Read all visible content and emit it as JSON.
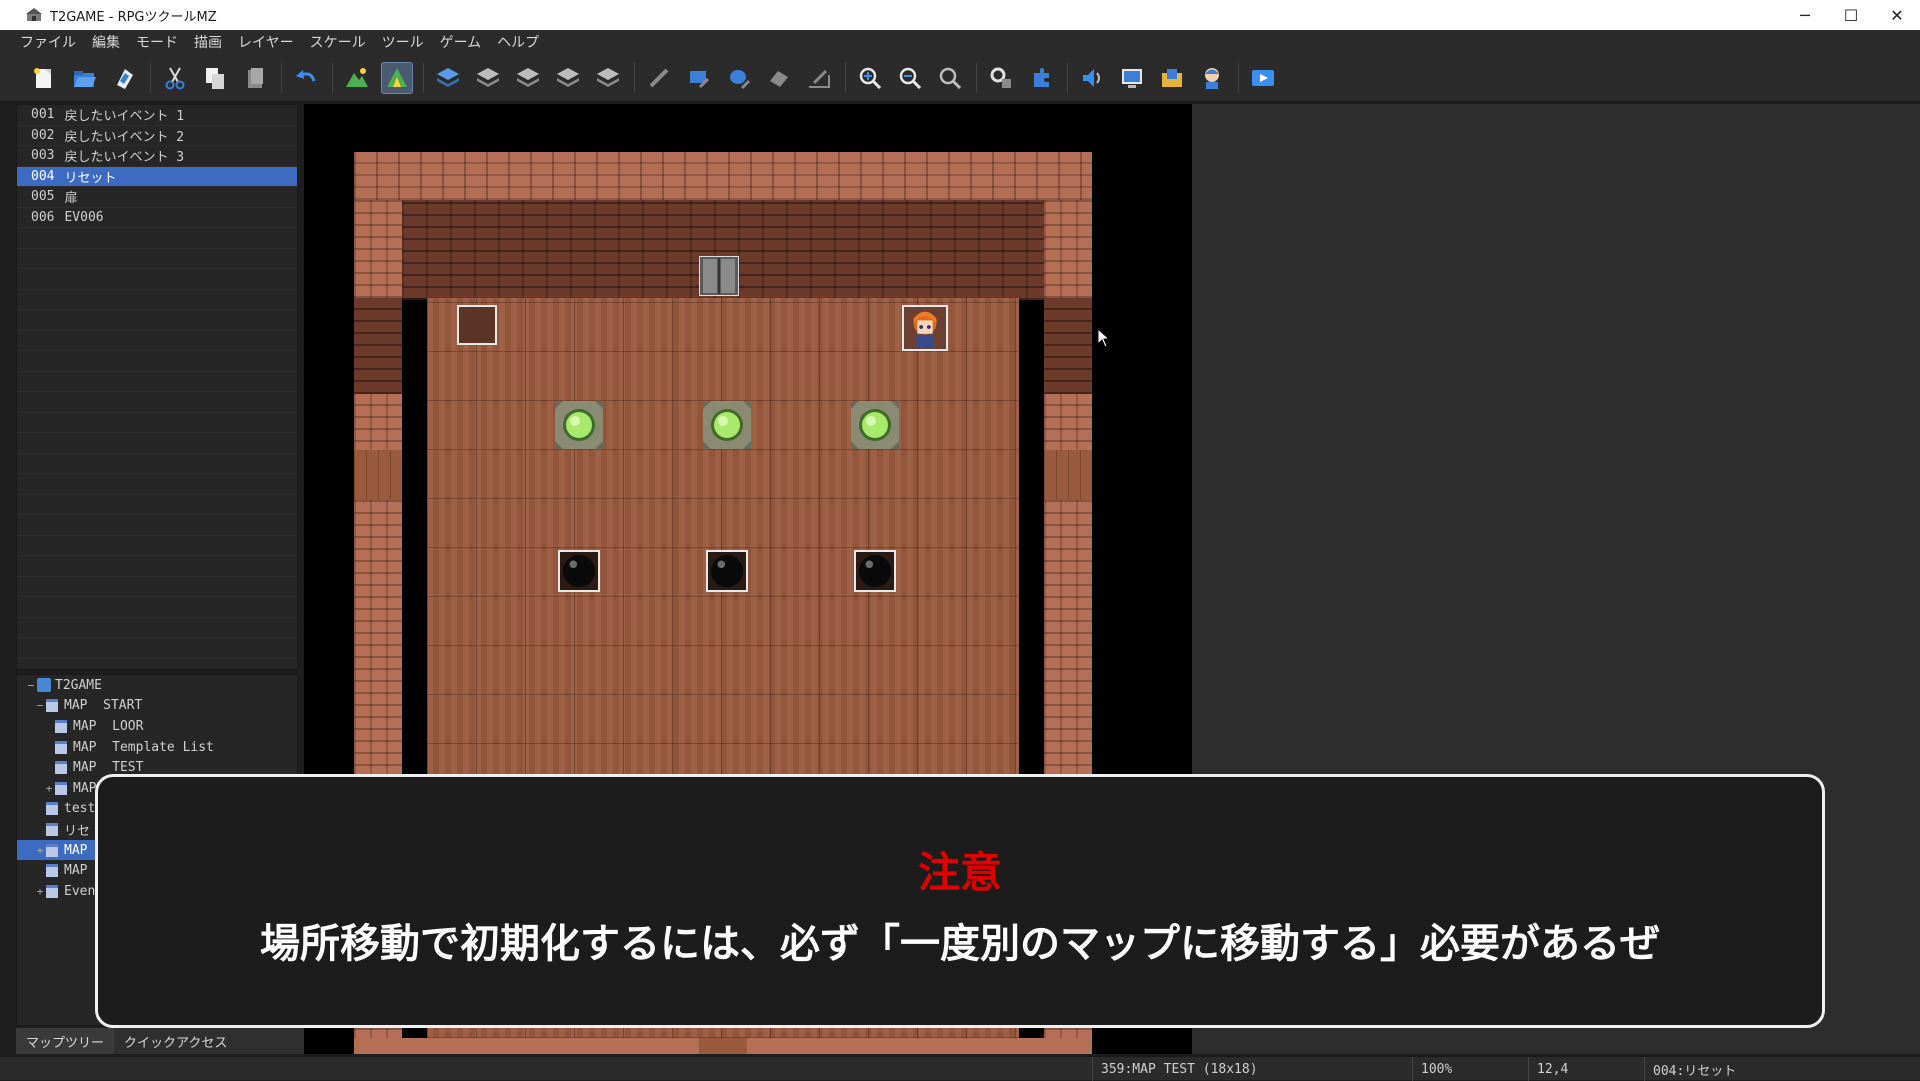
{
  "window": {
    "title": "T2GAME - RPGツクールMZ"
  },
  "menu": [
    "ファイル",
    "編集",
    "モード",
    "描画",
    "レイヤー",
    "スケール",
    "ツール",
    "ゲーム",
    "ヘルプ"
  ],
  "events": [
    {
      "num": "001",
      "name": "戻したいイベント 1"
    },
    {
      "num": "002",
      "name": "戻したいイベント 2"
    },
    {
      "num": "003",
      "name": "戻したいイベント 3"
    },
    {
      "num": "004",
      "name": "リセット"
    },
    {
      "num": "005",
      "name": "扉"
    },
    {
      "num": "006",
      "name": "EV006"
    }
  ],
  "tree": [
    {
      "label": "T2GAME",
      "indent": 0,
      "toggle": "−",
      "type": "project"
    },
    {
      "label": "MAP  START",
      "indent": 1,
      "toggle": "−",
      "type": "map"
    },
    {
      "label": "MAP  LOOR",
      "indent": 2,
      "toggle": "",
      "type": "map"
    },
    {
      "label": "MAP  Template List",
      "indent": 2,
      "toggle": "",
      "type": "map"
    },
    {
      "label": "MAP  TEST",
      "indent": 2,
      "toggle": "",
      "type": "map"
    },
    {
      "label": "MAP",
      "indent": 2,
      "toggle": "+",
      "type": "map"
    },
    {
      "label": "test",
      "indent": 1,
      "toggle": "",
      "type": "map"
    },
    {
      "label": "リセ",
      "indent": 1,
      "toggle": "",
      "type": "map"
    },
    {
      "label": "MAP",
      "indent": 1,
      "toggle": "+",
      "type": "map",
      "selected": true
    },
    {
      "label": "MAP",
      "indent": 1,
      "toggle": "",
      "type": "map"
    },
    {
      "label": "Even",
      "indent": 1,
      "toggle": "+",
      "type": "map"
    }
  ],
  "bottom_tabs": [
    "マップツリー",
    "クイックアクセス"
  ],
  "caption": {
    "head": "注意",
    "body": "場所移動で初期化するには、必ず「一度別のマップに移動する」必要があるぜ"
  },
  "status": {
    "map": "359:MAP  TEST (18x18)",
    "zoom": "100%",
    "coords": "12,4",
    "event": "004:リセット"
  },
  "colors": {
    "selection": "#3d6bc2",
    "caption_head": "#e00000"
  },
  "icons": [
    "new-project",
    "open-project",
    "save-project",
    "cut",
    "copy",
    "delete",
    "undo",
    "map-mode",
    "event-mode",
    "layer-1",
    "layer-2",
    "layer-3",
    "layer-4",
    "layer-auto",
    "pencil",
    "rectangle",
    "ellipse",
    "fill",
    "shadow-pen",
    "zoom-in",
    "zoom-out",
    "zoom-actual",
    "database",
    "plugin-manager",
    "sound-test",
    "event-searcher",
    "resource-manager",
    "character-generator",
    "playtest"
  ]
}
